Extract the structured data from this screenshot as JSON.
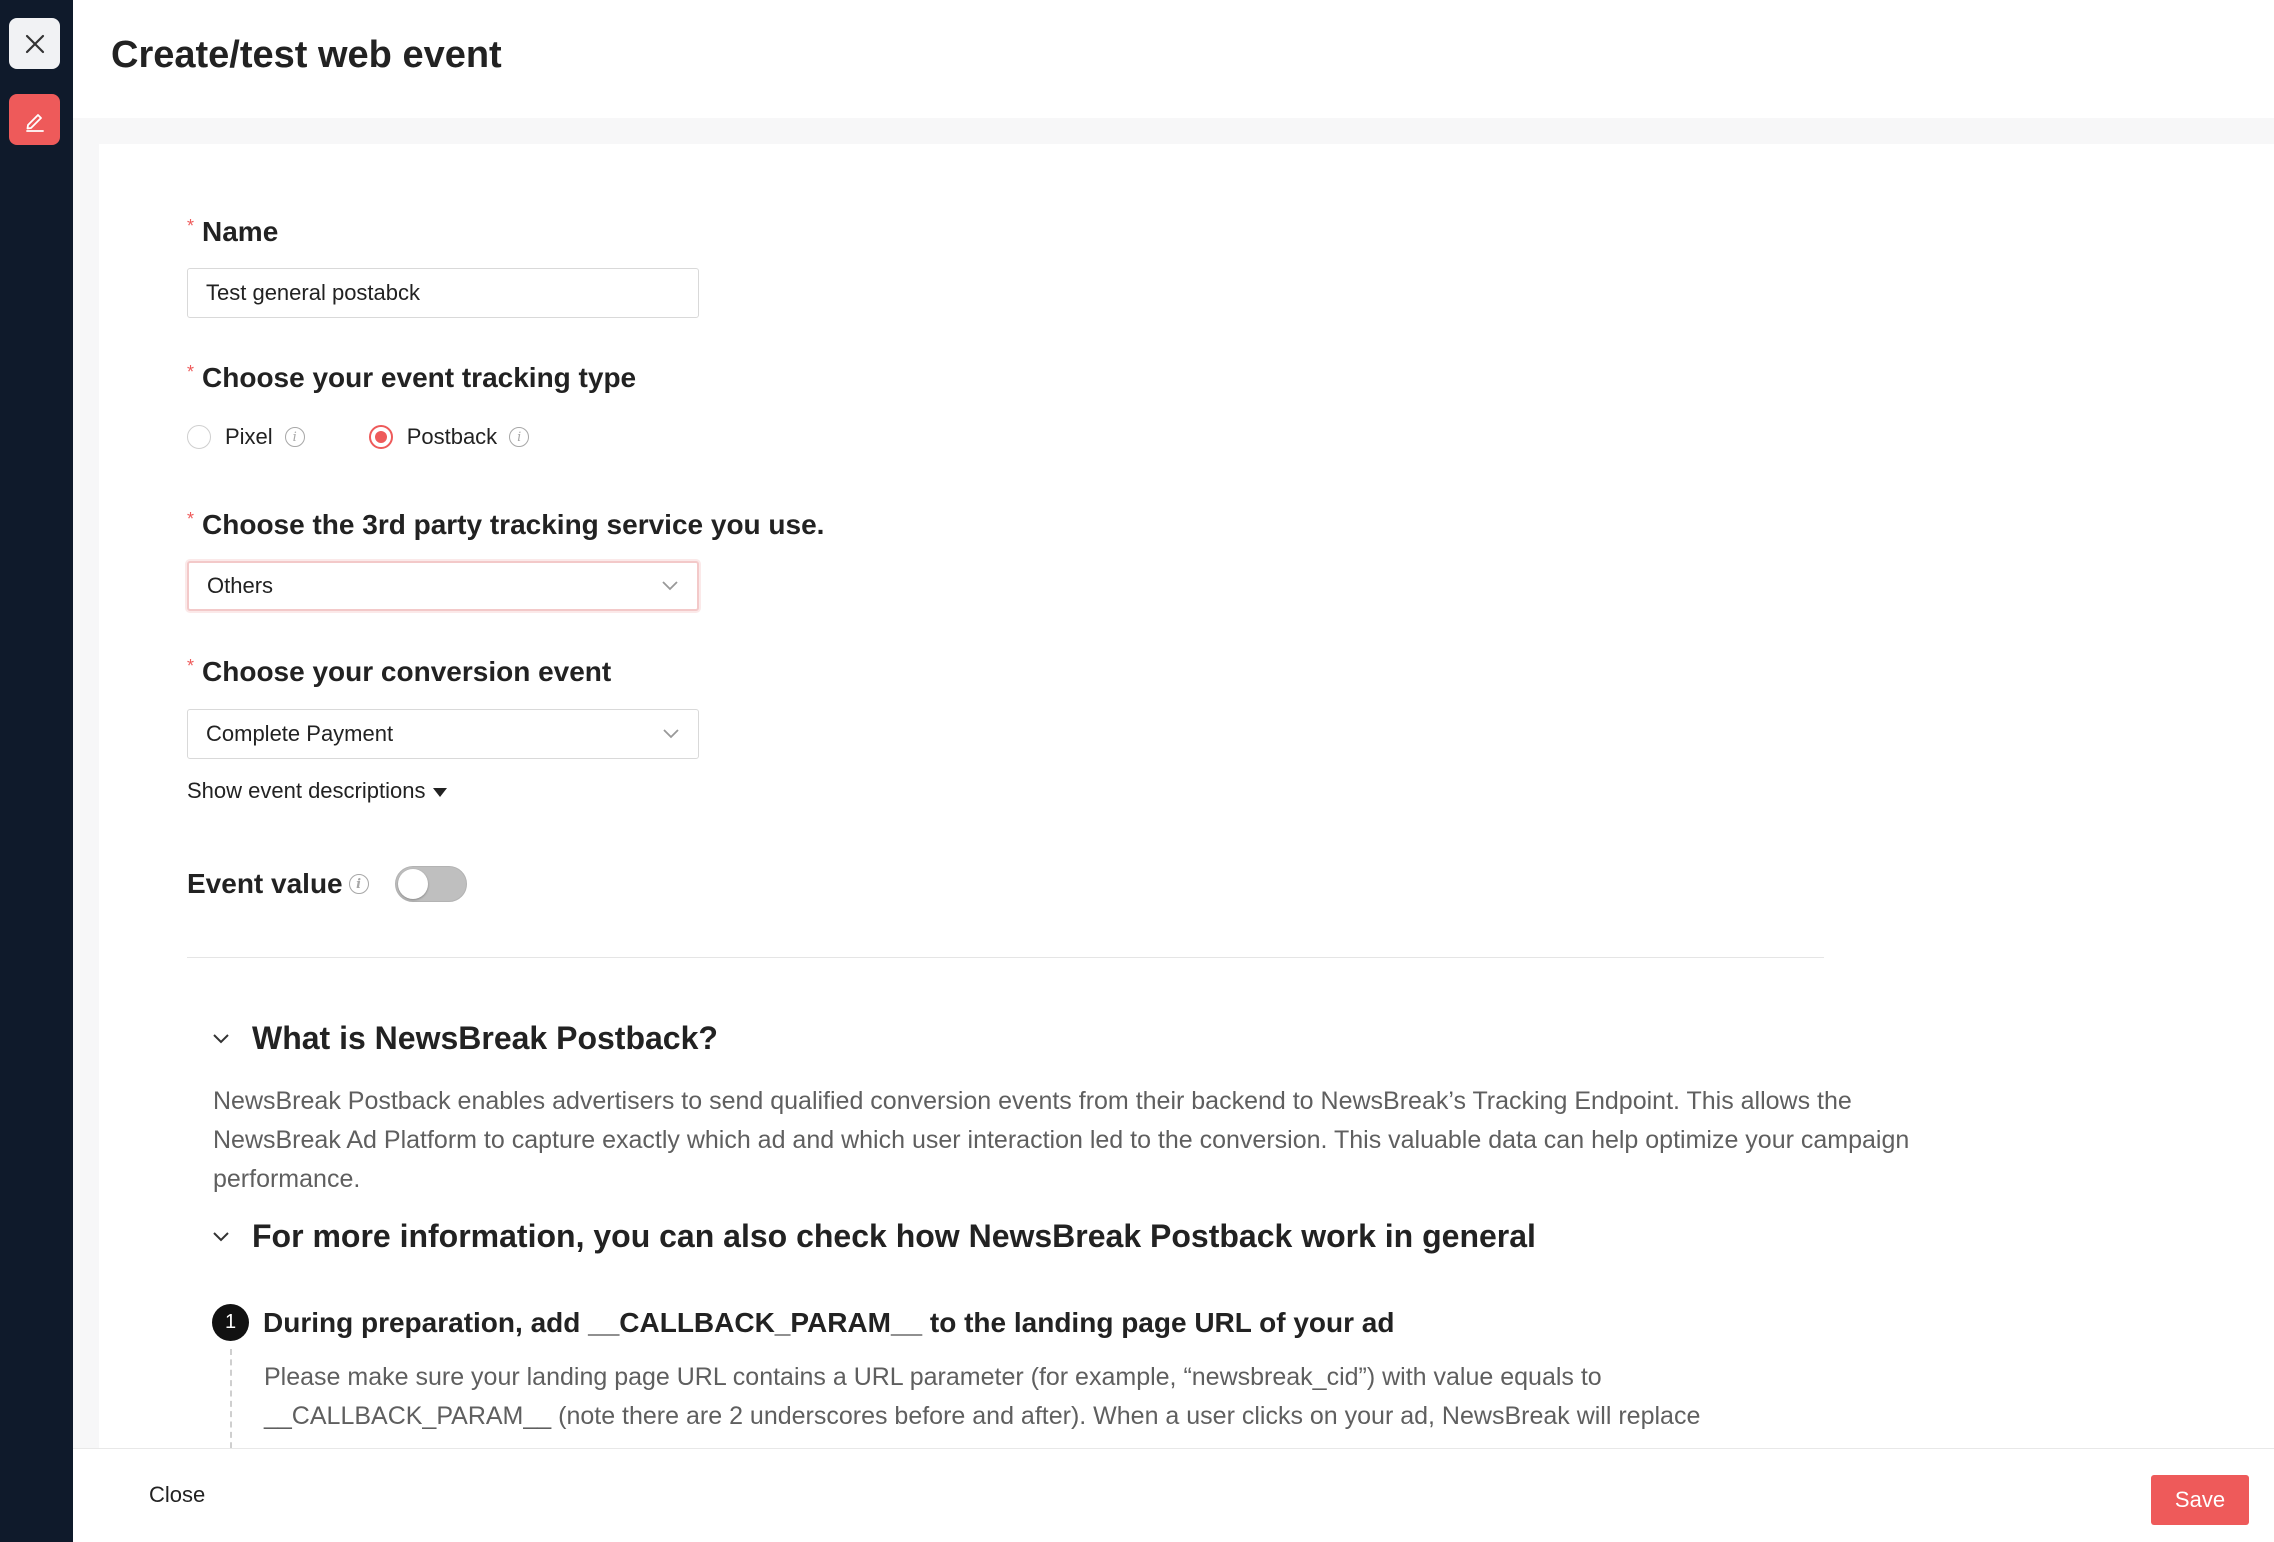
{
  "header": {
    "title": "Create/test web event"
  },
  "rail": {
    "close_icon": "close-icon",
    "edit_icon": "pencil-icon"
  },
  "form": {
    "name": {
      "label": "Name",
      "value": "Test general postabck"
    },
    "tracking_type": {
      "label": "Choose your event tracking type",
      "options": [
        {
          "label": "Pixel",
          "checked": false
        },
        {
          "label": "Postback",
          "checked": true
        }
      ]
    },
    "third_party": {
      "label": "Choose the 3rd party tracking service you use.",
      "value": "Others"
    },
    "conversion_event": {
      "label": "Choose your conversion event",
      "value": "Complete Payment"
    },
    "show_descriptions": "Show event descriptions",
    "event_value": {
      "label": "Event value",
      "enabled": false
    }
  },
  "info": {
    "what_is": {
      "title": "What is NewsBreak Postback?",
      "body": "NewsBreak Postback enables advertisers to send qualified conversion events from their backend to NewsBreak’s Tracking Endpoint. This allows the NewsBreak Ad Platform to capture exactly which ad and which user interaction led to the conversion. This valuable data can help optimize your campaign performance."
    },
    "more_info": {
      "title": "For more information, you can also check how NewsBreak Postback work in general"
    },
    "step1": {
      "number": "1",
      "title": "During preparation, add __CALLBACK_PARAM__ to the landing page URL of your ad",
      "body": "Please make sure your landing page URL contains a URL parameter (for example, “newsbreak_cid”) with value equals to __CALLBACK_PARAM__ (note there are 2 underscores before and after). When a user clicks on your ad, NewsBreak will replace"
    }
  },
  "footer": {
    "close_label": "Close",
    "save_label": "Save"
  },
  "colors": {
    "accent": "#ee5a5a",
    "rail": "#0f1a2b"
  }
}
